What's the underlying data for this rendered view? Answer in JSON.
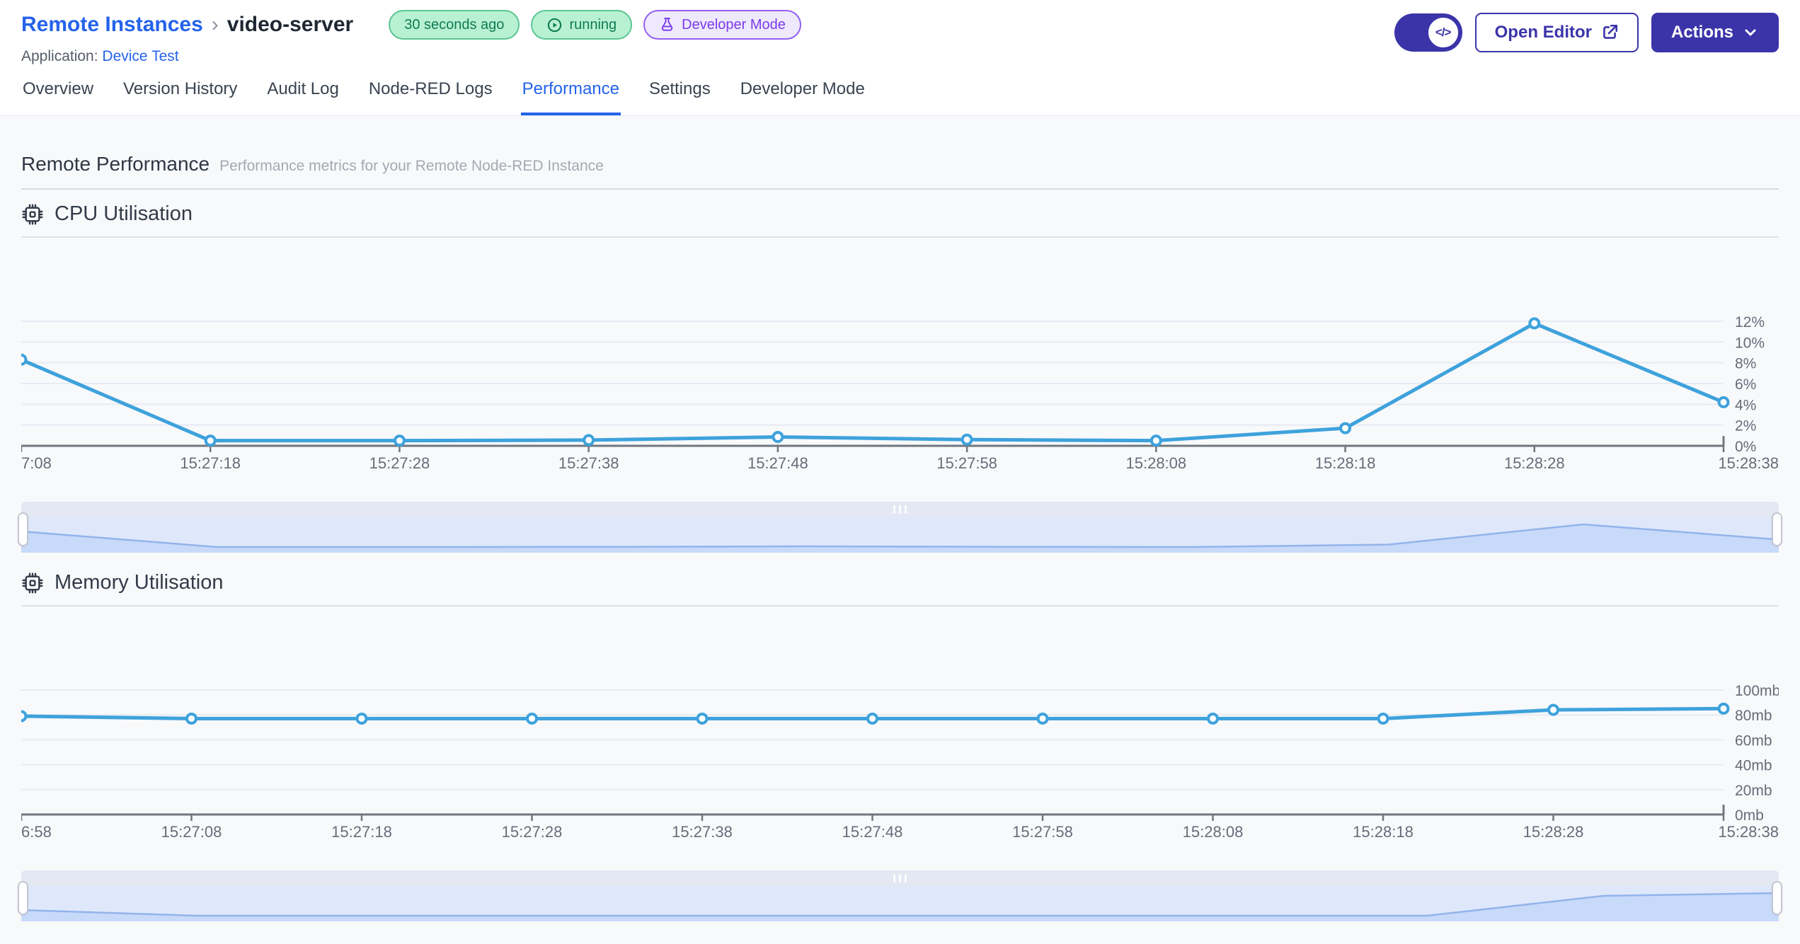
{
  "header": {
    "breadcrumb": {
      "parent": "Remote Instances",
      "separator": "›",
      "current": "video-server"
    },
    "badges": [
      {
        "label": "30 seconds ago"
      },
      {
        "label": "running",
        "icon": "play-circle"
      },
      {
        "label": "Developer Mode",
        "icon": "flask"
      }
    ],
    "application_label": "Application:",
    "application_name": "Device Test",
    "actions": {
      "toggle_glyph": "</>",
      "open_editor_label": "Open Editor",
      "actions_label": "Actions"
    }
  },
  "tabs": [
    {
      "label": "Overview",
      "active": false
    },
    {
      "label": "Version History",
      "active": false
    },
    {
      "label": "Audit Log",
      "active": false
    },
    {
      "label": "Node-RED Logs",
      "active": false
    },
    {
      "label": "Performance",
      "active": true
    },
    {
      "label": "Settings",
      "active": false
    },
    {
      "label": "Developer Mode",
      "active": false
    }
  ],
  "page": {
    "title": "Remote Performance",
    "subtitle": "Performance metrics for your Remote Node-RED Instance"
  },
  "colors": {
    "accent_indigo": "#3B34A9",
    "link_blue": "#2563EB",
    "chart_line": "#3EA2DC",
    "grid": "#E6ECF3",
    "axis": "#71767F",
    "axis_text": "#666D79",
    "brush_fill": "#C8DAF9",
    "brush_line": "#92B4EC"
  },
  "chart_data": [
    {
      "type": "line",
      "title": "CPU Utilisation",
      "icon": "cpu-chip",
      "x": [
        "7:08",
        "15:27:18",
        "15:27:28",
        "15:27:38",
        "15:27:48",
        "15:27:58",
        "15:28:08",
        "15:28:18",
        "15:28:28",
        "15:28:38"
      ],
      "series": [
        {
          "name": "CPU",
          "values": [
            8.3,
            0.5,
            0.5,
            0.55,
            0.85,
            0.6,
            0.5,
            1.7,
            11.8,
            4.2
          ]
        }
      ],
      "ylim": [
        0,
        12
      ],
      "yticks": {
        "values": [
          0,
          2,
          4,
          6,
          8,
          10,
          12
        ],
        "labels": [
          "0%",
          "2%",
          "4%",
          "6%",
          "8%",
          "10%",
          "12%"
        ]
      },
      "y_axis_side": "right",
      "grid": true,
      "brush": true
    },
    {
      "type": "line",
      "title": "Memory Utilisation",
      "icon": "cpu-chip",
      "x": [
        "6:58",
        "15:27:08",
        "15:27:18",
        "15:27:28",
        "15:27:38",
        "15:27:48",
        "15:27:58",
        "15:28:08",
        "15:28:18",
        "15:28:28",
        "15:28:38"
      ],
      "series": [
        {
          "name": "Memory",
          "values": [
            79,
            77,
            77,
            77,
            77,
            77,
            77,
            77,
            77,
            84,
            85
          ]
        }
      ],
      "ylim": [
        0,
        100
      ],
      "yticks": {
        "values": [
          0,
          20,
          40,
          60,
          80,
          100
        ],
        "labels": [
          "0mb",
          "20mb",
          "40mb",
          "60mb",
          "80mb",
          "100mb"
        ]
      },
      "y_axis_side": "right",
      "grid": true,
      "brush": true
    }
  ]
}
